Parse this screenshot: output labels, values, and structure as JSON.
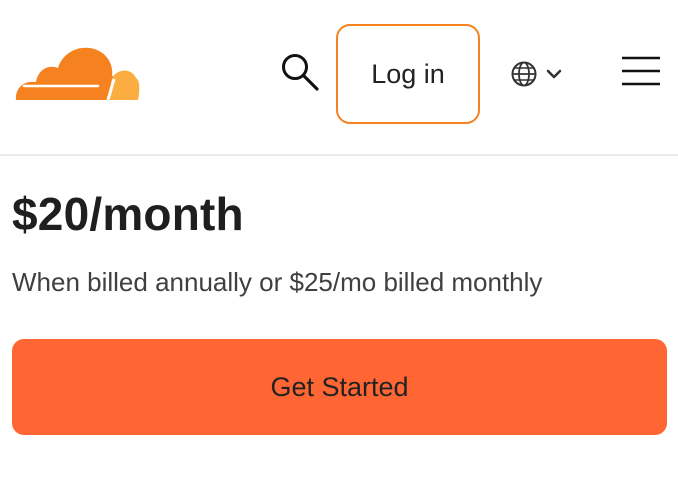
{
  "header": {
    "logo_name": "cloud-logo",
    "search_icon": "search-icon",
    "login_label": "Log in",
    "language_icon": "globe-icon",
    "language_chevron_icon": "chevron-down-icon",
    "menu_icon": "hamburger-menu-icon"
  },
  "pricing": {
    "price": "$20/month",
    "billing_note": "When billed annually or $25/mo billed monthly",
    "cta_label": "Get Started"
  },
  "colors": {
    "brand_orange": "#f6821f",
    "brand_light_orange": "#fbad41",
    "cta_background": "#ff6633",
    "text_dark": "#222222",
    "text_muted": "#404041",
    "divider": "#ececec"
  }
}
